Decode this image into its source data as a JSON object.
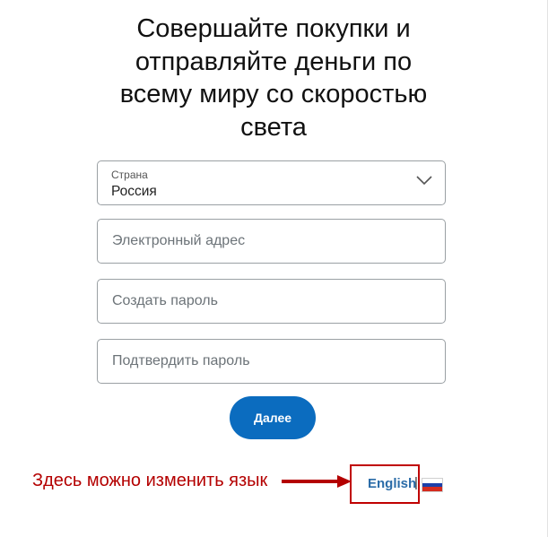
{
  "headline": {
    "line1": "Совершайте покупки и",
    "line2": "отправляйте деньги по",
    "line3": "всему миру со скоростью",
    "line4": "света"
  },
  "form": {
    "country": {
      "label": "Страна",
      "value": "Россия",
      "icon": "chevron-down-icon"
    },
    "email": {
      "placeholder": "Электронный адрес",
      "value": ""
    },
    "password": {
      "placeholder": "Создать пароль",
      "value": ""
    },
    "confirm_password": {
      "placeholder": "Подтвердить пароль",
      "value": ""
    },
    "next_label": "Далее"
  },
  "annotation": {
    "text": "Здесь можно изменить язык",
    "color": "#b40000"
  },
  "language": {
    "option_label": "English",
    "separator": "|",
    "current_flag": "russia-flag-icon"
  },
  "colors": {
    "primary_button": "#0b6cbf",
    "link": "#2b6ca8",
    "highlight": "#c00000"
  }
}
